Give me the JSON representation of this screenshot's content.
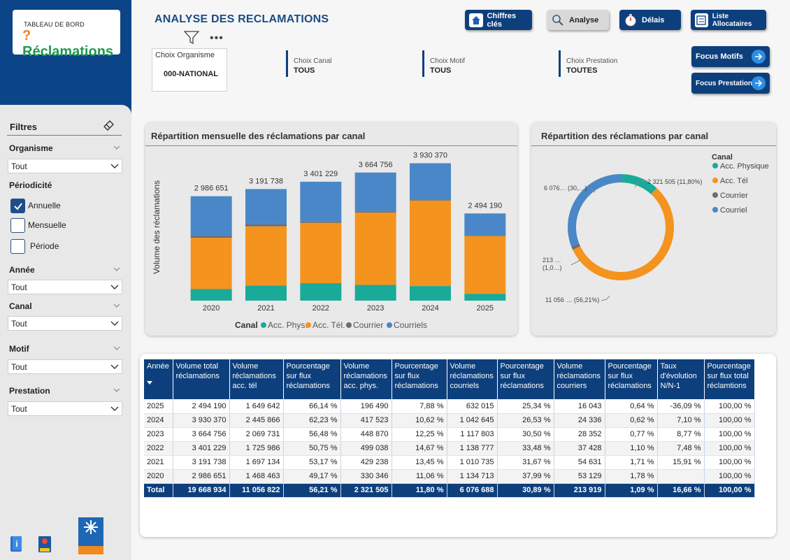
{
  "logo": {
    "small": "TABLEAU DE BORD",
    "big": "Réclamations"
  },
  "sidebar": {
    "title": "Filtres",
    "organisme_label": "Organisme",
    "organisme_value": "Tout",
    "periodicite_label": "Périodicité",
    "periodicite_options": [
      "Annuelle",
      "Mensuelle",
      "Période"
    ],
    "periodicite_selected": "Annuelle",
    "annee_label": "Année",
    "annee_value": "Tout",
    "canal_label": "Canal",
    "canal_value": "Tout",
    "motif_label": "Motif",
    "motif_value": "Tout",
    "prestation_label": "Prestation",
    "prestation_value": "Tout"
  },
  "header": {
    "title": "ANALYSE DES RECLAMATIONS",
    "nav": [
      "Chiffres clés",
      "Analyse",
      "Délais",
      "Liste Allocataires"
    ],
    "active_nav": "Analyse",
    "focus": [
      "Focus Motifs",
      "Focus Prestations"
    ]
  },
  "filters": {
    "organisme_label": "Choix Organisme",
    "organisme_value": "000-NATIONAL",
    "canal_label": "Choix Canal",
    "canal_value": "TOUS",
    "motif_label": "Choix Motif",
    "motif_value": "TOUS",
    "prestation_label": "Choix Prestation",
    "prestation_value": "TOUTES"
  },
  "colors": {
    "phys": "#19aa9a",
    "tel": "#f5931f",
    "courrier": "#6d6d6d",
    "courriel": "#4a87c8",
    "navy": "#0d3f7c"
  },
  "chart_data": [
    {
      "type": "bar",
      "stacked": true,
      "title": "Répartition mensuelle des réclamations par canal",
      "ylabel": "Volume des réclamations",
      "categories": [
        "2020",
        "2021",
        "2022",
        "2023",
        "2024",
        "2025"
      ],
      "totals_labels": [
        "2 986 651",
        "3 191 738",
        "3 401 229",
        "3 664 756",
        "3 930 370",
        "2 494 190"
      ],
      "totals": [
        2986651,
        3191738,
        3401229,
        3664756,
        3930370,
        2494190
      ],
      "series": [
        {
          "name": "Acc. Phys.",
          "values": [
            330346,
            429238,
            499038,
            448870,
            417523,
            196490
          ]
        },
        {
          "name": "Acc. Tél.",
          "values": [
            1468463,
            1697134,
            1725986,
            2069731,
            2445866,
            1649642
          ]
        },
        {
          "name": "Courrier",
          "values": [
            53129,
            54631,
            37428,
            28352,
            24336,
            16043
          ]
        },
        {
          "name": "Courriels",
          "values": [
            1134713,
            1010735,
            1138777,
            1117803,
            1042645,
            632015
          ]
        }
      ],
      "legend_title": "Canal"
    },
    {
      "type": "pie",
      "donut": true,
      "title": "Répartition des réclamations par canal",
      "legend_title": "Canal",
      "labels": [
        "Acc. Physique",
        "Acc. Tél",
        "Courrier",
        "Courriel"
      ],
      "values": [
        2321505,
        11056822,
        213919,
        6076688
      ],
      "data_labels": [
        "2 321 505 (11,80%)",
        "11 056 … (56,21%)",
        "213 … (1,0…)",
        "6 076… (30,…)"
      ]
    }
  ],
  "table": {
    "headers": [
      "Année",
      "Volume total réclamations",
      "Volume réclamations acc. tél",
      "Pourcentage sur flux réclamations",
      "Volume réclamations acc. phys.",
      "Pourcentage sur flux réclamations",
      "Volume réclamations courriels",
      "Pourcentage sur flux réclamations",
      "Volume réclamations courriers",
      "Pourcentage sur flux réclamations",
      "Taux d'évolution N/N-1",
      "Pourcentage sur flux total réclamtions"
    ],
    "rows": [
      [
        "2025",
        "2 494 190",
        "1 649 642",
        "66,14 %",
        "196 490",
        "7,88 %",
        "632 015",
        "25,34 %",
        "16 043",
        "0,64 %",
        "-36,09 %",
        "100,00 %"
      ],
      [
        "2024",
        "3 930 370",
        "2 445 866",
        "62,23 %",
        "417 523",
        "10,62 %",
        "1 042 645",
        "26,53 %",
        "24 336",
        "0,62 %",
        "7,10 %",
        "100,00 %"
      ],
      [
        "2023",
        "3 664 756",
        "2 069 731",
        "56,48 %",
        "448 870",
        "12,25 %",
        "1 117 803",
        "30,50 %",
        "28 352",
        "0,77 %",
        "8,77 %",
        "100,00 %"
      ],
      [
        "2022",
        "3 401 229",
        "1 725 986",
        "50,75 %",
        "499 038",
        "14,67 %",
        "1 138 777",
        "33,48 %",
        "37 428",
        "1,10 %",
        "7,48 %",
        "100,00 %"
      ],
      [
        "2021",
        "3 191 738",
        "1 697 134",
        "53,17 %",
        "429 238",
        "13,45 %",
        "1 010 735",
        "31,67 %",
        "54 631",
        "1,71 %",
        "15,91 %",
        "100,00 %"
      ],
      [
        "2020",
        "2 986 651",
        "1 468 463",
        "49,17 %",
        "330 346",
        "11,06 %",
        "1 134 713",
        "37,99 %",
        "53 129",
        "1,78 %",
        "",
        "100,00 %"
      ]
    ],
    "total": [
      "Total",
      "19 668 934",
      "11 056 822",
      "56,21 %",
      "2 321 505",
      "11,80 %",
      "6 076 688",
      "30,89 %",
      "213 919",
      "1,09 %",
      "16,66 %",
      "100,00 %"
    ]
  }
}
